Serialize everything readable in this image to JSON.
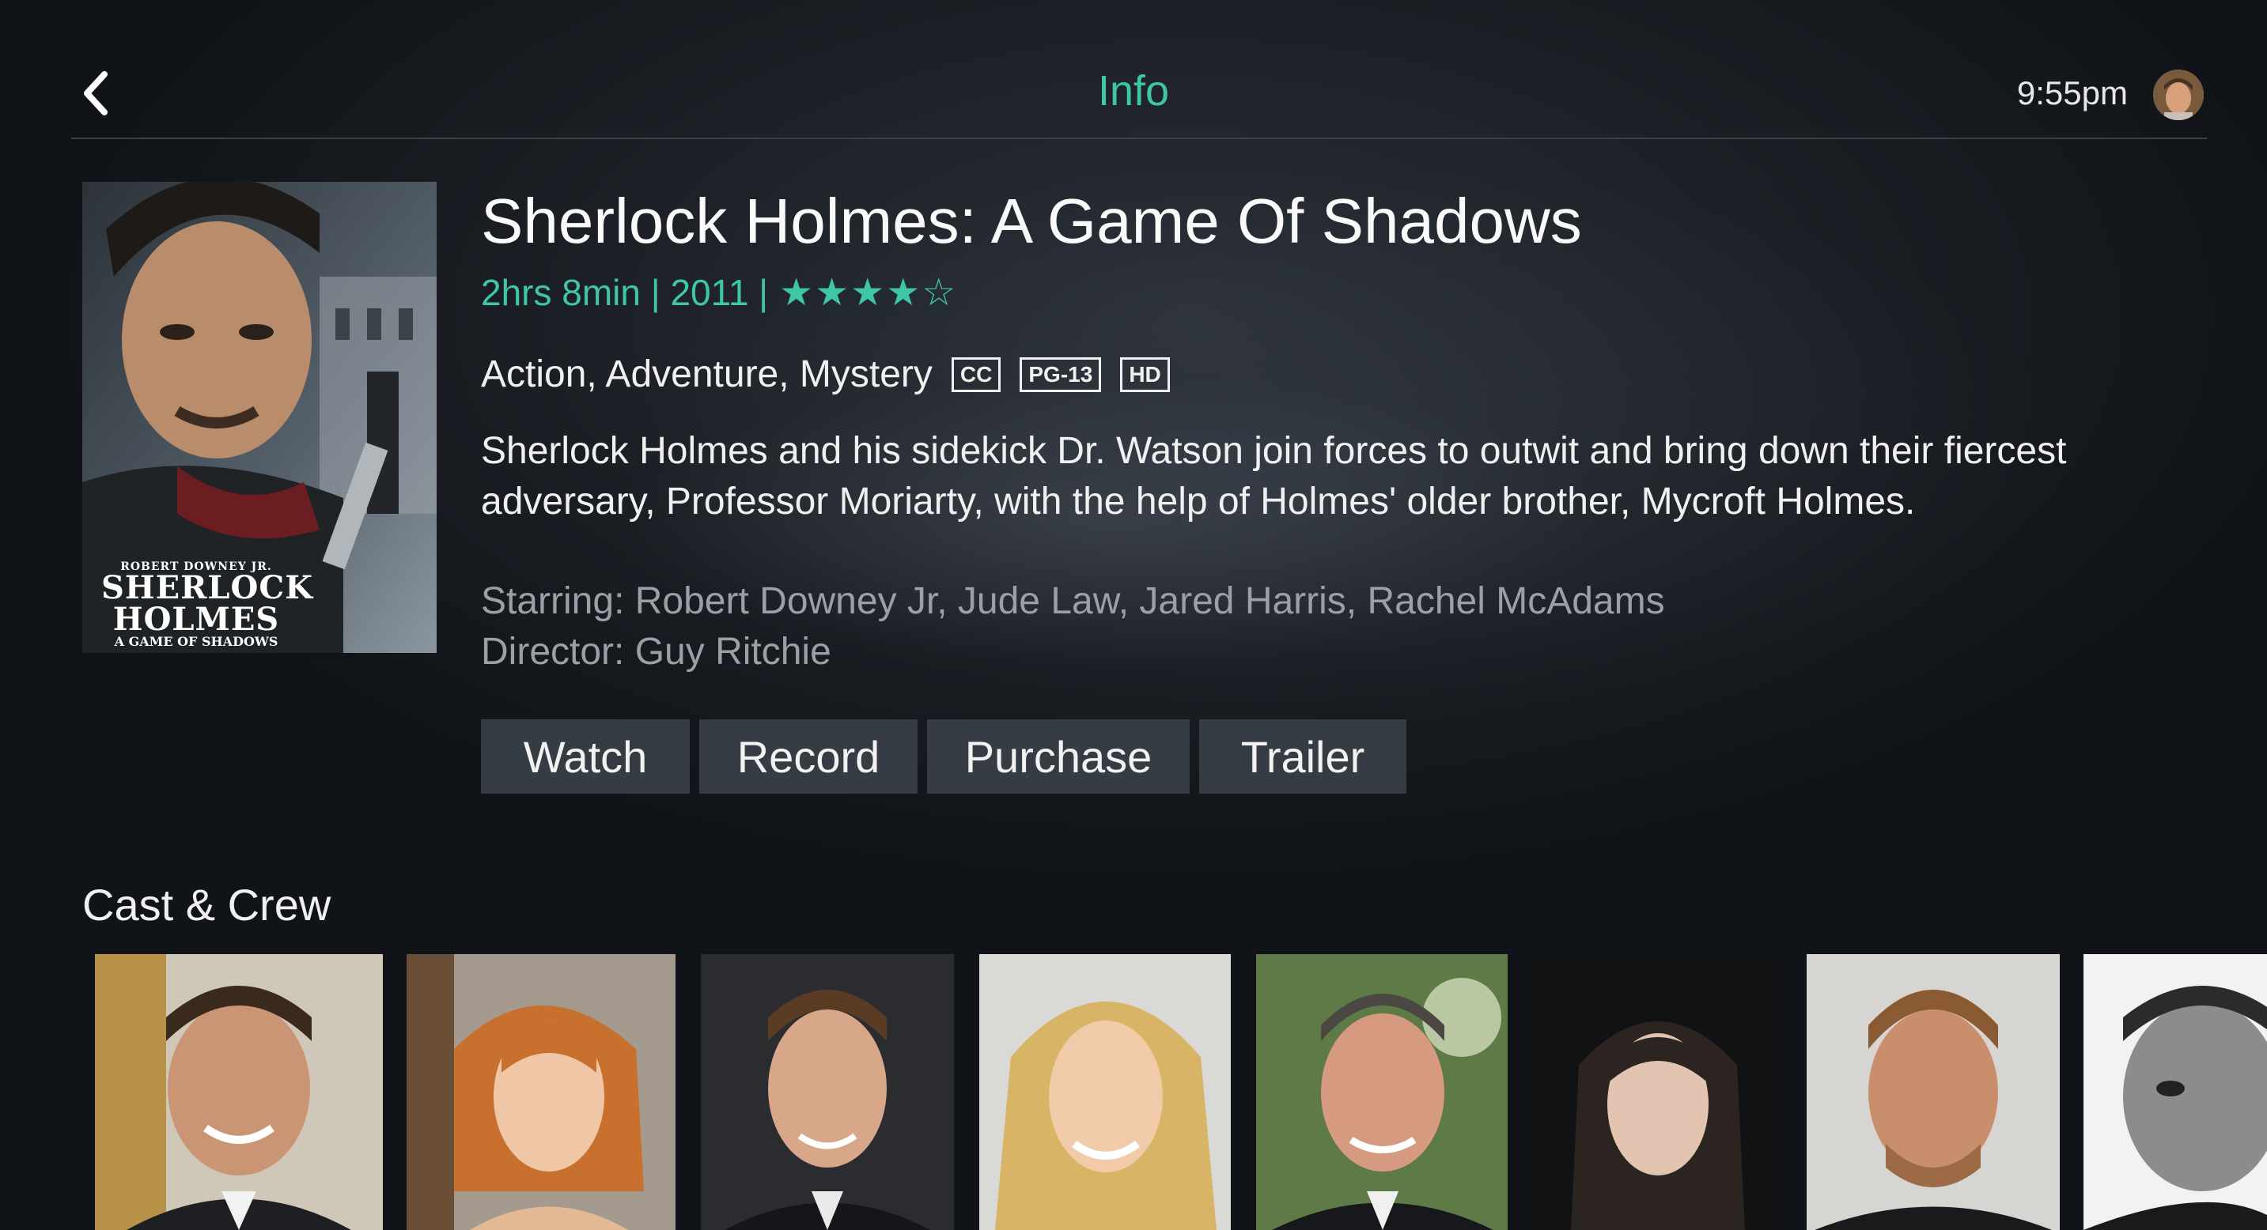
{
  "header": {
    "title": "Info",
    "time": "9:55pm"
  },
  "movie": {
    "title": "Sherlock Holmes: A Game Of Shadows",
    "meta": "2hrs 8min | 2011 |",
    "rating_stars": 4,
    "rating_max": 5,
    "genres": "Action, Adventure, Mystery",
    "badges": [
      "CC",
      "PG-13",
      "HD"
    ],
    "synopsis": "Sherlock Holmes and his sidekick Dr. Watson join forces to outwit and bring down their fiercest adversary, Professor Moriarty, with the help of Holmes' older brother, Mycroft Holmes.",
    "starring": "Starring: Robert Downey Jr, Jude Law, Jared Harris, Rachel McAdams",
    "director": "Director: Guy Ritchie",
    "poster": {
      "line1": "ROBERT DOWNEY JR.",
      "line2": "SHERLOCK",
      "line3": "HOLMES",
      "line4": "A GAME OF SHADOWS"
    }
  },
  "actions": {
    "watch": "Watch",
    "record": "Record",
    "purchase": "Purchase",
    "trailer": "Trailer"
  },
  "cast": {
    "heading": "Cast & Crew",
    "count": 8
  },
  "colors": {
    "accent": "#3ec6a6",
    "button_bg": "#353c44",
    "muted_text": "#9aa0a6"
  }
}
